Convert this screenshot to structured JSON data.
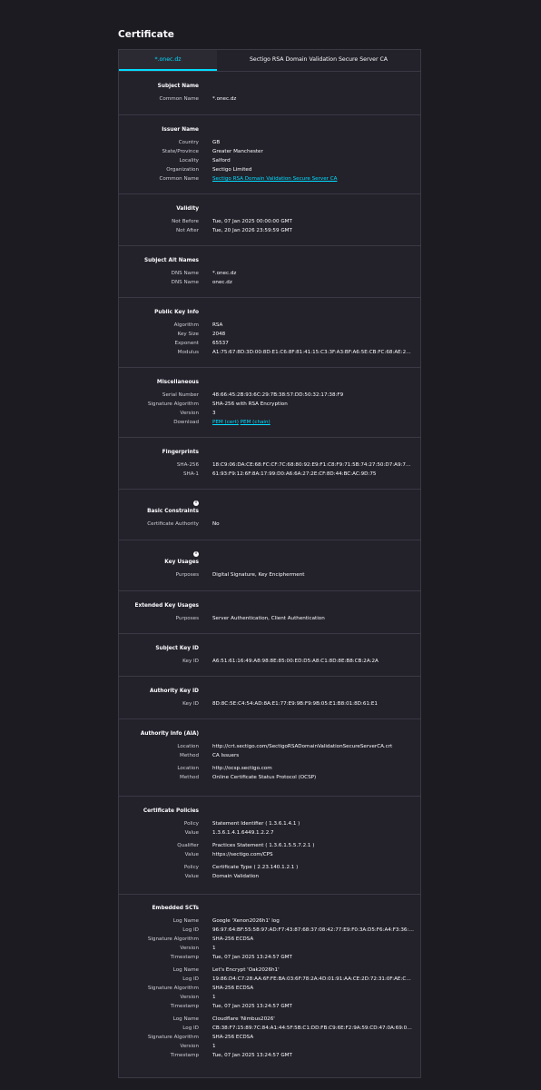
{
  "page_title": "Certificate",
  "tabs": [
    "*.onec.dz",
    "Sectigo RSA Domain Validation Secure Server CA"
  ],
  "sections": {
    "subject_name": {
      "title": "Subject Name",
      "rows": [
        {
          "label": "Common Name",
          "value": "*.onec.dz"
        }
      ]
    },
    "issuer_name": {
      "title": "Issuer Name",
      "rows": [
        {
          "label": "Country",
          "value": "GB"
        },
        {
          "label": "State/Province",
          "value": "Greater Manchester"
        },
        {
          "label": "Locality",
          "value": "Salford"
        },
        {
          "label": "Organization",
          "value": "Sectigo Limited"
        },
        {
          "label": "Common Name",
          "value": "Sectigo RSA Domain Validation Secure Server CA"
        }
      ]
    },
    "validity": {
      "title": "Validity",
      "rows": [
        {
          "label": "Not Before",
          "value": "Tue, 07 Jan 2025 00:00:00 GMT"
        },
        {
          "label": "Not After",
          "value": "Tue, 20 Jan 2026 23:59:59 GMT"
        }
      ]
    },
    "subject_alt_names": {
      "title": "Subject Alt Names",
      "rows": [
        {
          "label": "DNS Name",
          "value": "*.onec.dz"
        },
        {
          "label": "DNS Name",
          "value": "onec.dz"
        }
      ]
    },
    "public_key_info": {
      "title": "Public Key Info",
      "rows": [
        {
          "label": "Algorithm",
          "value": "RSA"
        },
        {
          "label": "Key Size",
          "value": "2048"
        },
        {
          "label": "Exponent",
          "value": "65537"
        },
        {
          "label": "Modulus",
          "value": "A1:75:67:8D:3D:00:8D:E1:C6:8F:81:41:15:C3:3F:A3:BF:A6:5E:CB:FC:68:AE:20:CB:..."
        }
      ]
    },
    "miscellaneous": {
      "title": "Miscellaneous",
      "rows": [
        {
          "label": "Serial Number",
          "value": "48:66:45:2B:93:6C:29:7B:38:57:DD:50:32:17:38:F9"
        },
        {
          "label": "Signature Algorithm",
          "value": "SHA-256 with RSA Encryption"
        },
        {
          "label": "Version",
          "value": "3"
        },
        {
          "label": "Download",
          "value": ""
        }
      ],
      "download_links": [
        "PEM (cert)",
        "PEM (chain)"
      ]
    },
    "fingerprints": {
      "title": "Fingerprints",
      "rows": [
        {
          "label": "SHA-256",
          "value": "18:C9:06:DA:CE:68:FC:CF:7C:68:80:92:E9:F1:C8:F9:71:5B:74:27:50:D7:A9:70:61:2..."
        },
        {
          "label": "SHA-1",
          "value": "61:93:F9:12:6F:8A:17:99:D0:A6:6A:27:2E:CF:8D:44:BC:AC:9D:75"
        }
      ]
    },
    "basic_constraints": {
      "title": "Basic Constraints",
      "info": "i",
      "rows": [
        {
          "label": "Certificate Authority",
          "value": "No"
        }
      ]
    },
    "key_usages": {
      "title": "Key Usages",
      "info": "i",
      "rows": [
        {
          "label": "Purposes",
          "value": "Digital Signature, Key Encipherment"
        }
      ]
    },
    "extended_key_usages": {
      "title": "Extended Key Usages",
      "rows": [
        {
          "label": "Purposes",
          "value": "Server Authentication, Client Authentication"
        }
      ]
    },
    "subject_key_id": {
      "title": "Subject Key ID",
      "rows": [
        {
          "label": "Key ID",
          "value": "A6:51:61:16:49:A8:98:8E:85:00:ED:D5:A8:C1:8D:8E:B8:CB:2A:2A"
        }
      ]
    },
    "authority_key_id": {
      "title": "Authority Key ID",
      "rows": [
        {
          "label": "Key ID",
          "value": "8D:8C:5E:C4:54:AD:8A:E1:77:E9:9B:F9:9B:05:E1:B8:01:8D:61:E1"
        }
      ]
    },
    "authority_info": {
      "title": "Authority Info (AIA)",
      "rows": [
        {
          "label": "Location",
          "value": "http://crt.sectigo.com/SectigoRSADomainValidationSecureServerCA.crt"
        },
        {
          "label": "Method",
          "value": "CA Issuers"
        },
        {
          "label": "Location",
          "value": "http://ocsp.sectigo.com"
        },
        {
          "label": "Method",
          "value": "Online Certificate Status Protocol (OCSP)"
        }
      ]
    },
    "certificate_policies": {
      "title": "Certificate Policies",
      "rows": [
        {
          "label": "Policy",
          "value": "Statement Identifier ( 1.3.6.1.4.1 )"
        },
        {
          "label": "Value",
          "value": "1.3.6.1.4.1.6449.1.2.2.7"
        },
        {
          "label": "Qualifier",
          "value": "Practices Statement ( 1.3.6.1.5.5.7.2.1 )"
        },
        {
          "label": "Value",
          "value": "https://sectigo.com/CPS"
        },
        {
          "label": "Policy",
          "value": "Certificate Type ( 2.23.140.1.2.1 )"
        },
        {
          "label": "Value",
          "value": "Domain Validation"
        }
      ]
    },
    "embedded_scts": {
      "title": "Embedded SCTs",
      "rows": [
        {
          "label": "Log Name",
          "value": "Google 'Xenon2026h1' log"
        },
        {
          "label": "Log ID",
          "value": "96:97:64:BF:55:58:97:AD:F7:43:87:68:37:08:42:77:E9:F0:3A:D5:F6:A4:F3:36:6E:46:..."
        },
        {
          "label": "Signature Algorithm",
          "value": "SHA-256 ECDSA"
        },
        {
          "label": "Version",
          "value": "1"
        },
        {
          "label": "Timestamp",
          "value": "Tue, 07 Jan 2025 13:24:57 GMT"
        },
        {
          "label": "Log Name",
          "value": "Let's Encrypt 'Oak2026h1'"
        },
        {
          "label": "Log ID",
          "value": "19:86:D4:C7:28:AA:6F:FE:BA:03:6F:78:2A:4D:01:91:AA:CE:2D:72:31:0F:AE:CE:5D:..."
        },
        {
          "label": "Signature Algorithm",
          "value": "SHA-256 ECDSA"
        },
        {
          "label": "Version",
          "value": "1"
        },
        {
          "label": "Timestamp",
          "value": "Tue, 07 Jan 2025 13:24:57 GMT"
        },
        {
          "label": "Log Name",
          "value": "Cloudflare 'Nimbus2026'"
        },
        {
          "label": "Log ID",
          "value": "CB:38:F7:15:89:7C:84:A1:44:5F:5B:C1:DD:FB:C9:6E:F2:9A:59:CD:47:0A:69:05:85:B..."
        },
        {
          "label": "Signature Algorithm",
          "value": "SHA-256 ECDSA"
        },
        {
          "label": "Version",
          "value": "1"
        },
        {
          "label": "Timestamp",
          "value": "Tue, 07 Jan 2025 13:24:57 GMT"
        }
      ]
    }
  }
}
